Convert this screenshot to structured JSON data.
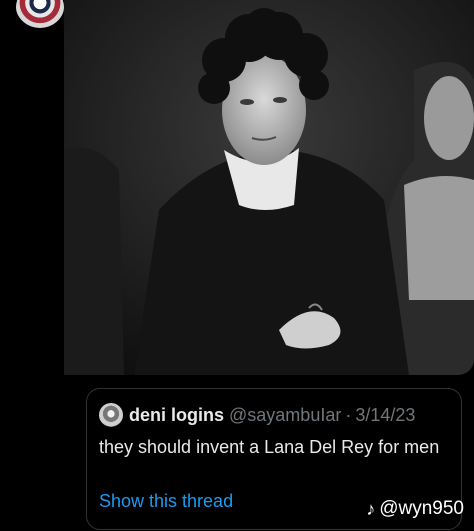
{
  "tweet": {
    "avatar_icon": "profile-avatar",
    "media_alt": "black-and-white-photo",
    "quote": {
      "avatar_icon": "quote-author-avatar",
      "display_name": "deni logins",
      "handle": "@sayambuIar",
      "separator": "·",
      "date": "3/14/23",
      "text": "they should invent a Lana Del Rey for men",
      "show_thread_label": "Show this thread"
    }
  },
  "watermark": {
    "icon": "tiktok-icon",
    "text": "@wyn950"
  },
  "colors": {
    "background": "#000000",
    "link": "#1d9bf0",
    "secondary_text": "#71767b",
    "primary_text": "#e7e9ea"
  }
}
